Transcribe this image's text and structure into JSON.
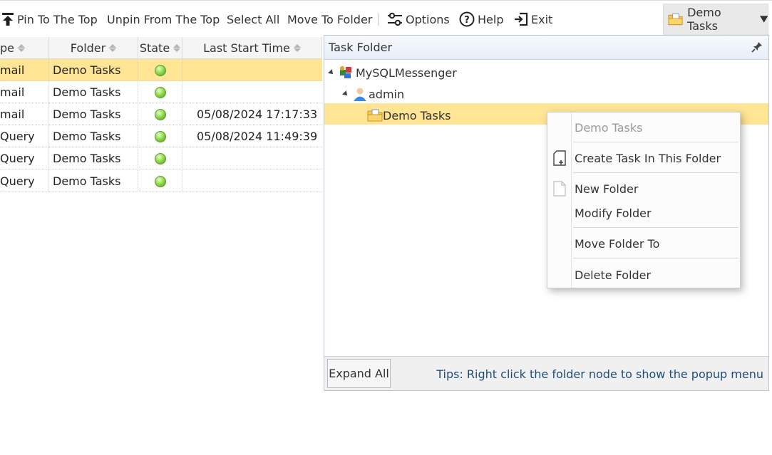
{
  "toolbar": {
    "pin_to_top": "Pin To The Top",
    "unpin_from_top": "Unpin From The Top",
    "select_all": "Select All",
    "move_to_folder": "Move To Folder",
    "options": "Options",
    "help": "Help",
    "exit": "Exit",
    "folder_selector": "Demo Tasks"
  },
  "grid": {
    "columns": {
      "type": "pe",
      "folder": "Folder",
      "state": "State",
      "last_start_time": "Last Start Time"
    },
    "rows": [
      {
        "type": "mail",
        "folder": "Demo Tasks",
        "state": "active",
        "last_start_time": ""
      },
      {
        "type": "mail",
        "folder": "Demo Tasks",
        "state": "active",
        "last_start_time": ""
      },
      {
        "type": "mail",
        "folder": "Demo Tasks",
        "state": "active",
        "last_start_time": "05/08/2024 17:17:33"
      },
      {
        "type": "Query",
        "folder": "Demo Tasks",
        "state": "active",
        "last_start_time": "05/08/2024 11:49:39"
      },
      {
        "type": "Query",
        "folder": "Demo Tasks",
        "state": "active",
        "last_start_time": ""
      },
      {
        "type": "Query",
        "folder": "Demo Tasks",
        "state": "active",
        "last_start_time": ""
      }
    ],
    "selected_color": "#ffe594"
  },
  "task_folder": {
    "title": "Task Folder",
    "tree": {
      "root": "MySQLMessenger",
      "user": "admin",
      "folder": "Demo Tasks"
    },
    "expand_all": "Expand All",
    "tips": "Tips: Right click the folder node to show the popup menu"
  },
  "context_menu": {
    "header": "Demo Tasks",
    "create_task": "Create Task In This Folder",
    "new_folder": "New Folder",
    "modify_folder": "Modify Folder",
    "move_folder_to": "Move Folder To",
    "delete_folder": "Delete Folder"
  }
}
